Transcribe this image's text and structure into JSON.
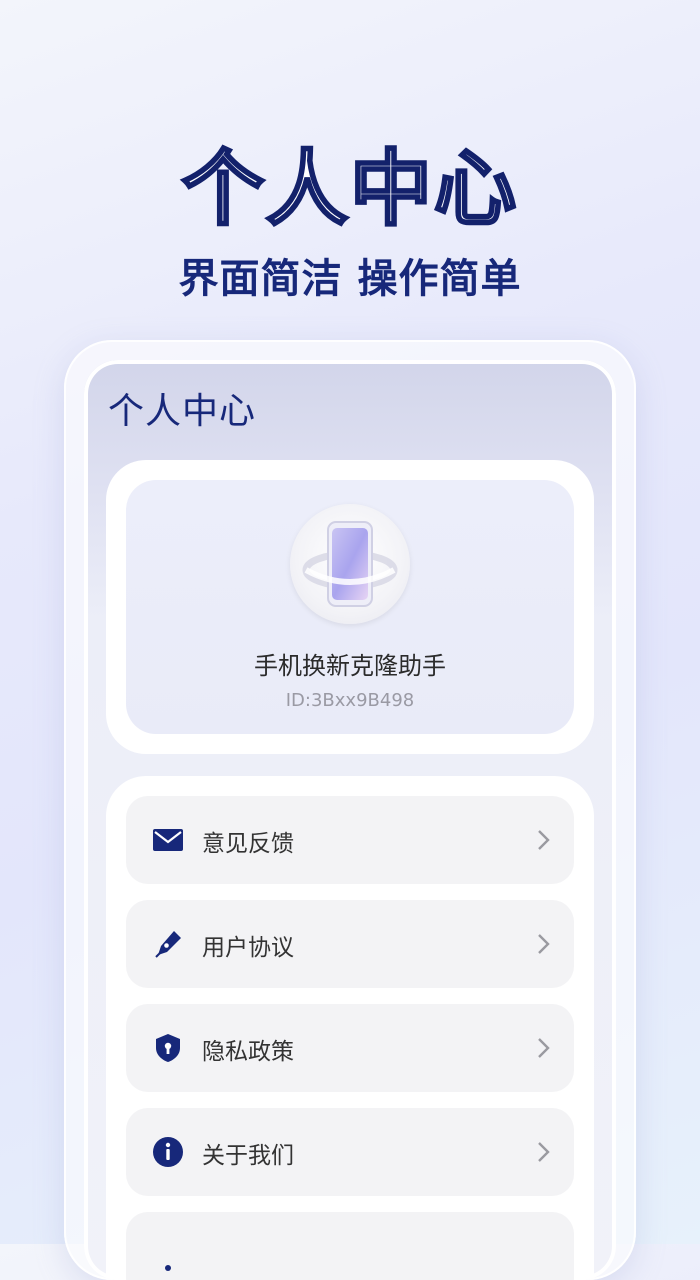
{
  "hero": {
    "title": "个人中心",
    "subtitle": "界面简洁 操作简单"
  },
  "screen": {
    "title": "个人中心",
    "profile": {
      "app_name": "手机换新克隆助手",
      "id_text": "ID:3Bxx9B498",
      "avatar_icon": "phone-clone-logo-icon"
    },
    "menu": [
      {
        "label": "意见反馈",
        "icon": "mail-icon"
      },
      {
        "label": "用户协议",
        "icon": "pen-icon"
      },
      {
        "label": "隐私政策",
        "icon": "shield-lock-icon"
      },
      {
        "label": "关于我们",
        "icon": "info-icon"
      }
    ]
  },
  "colors": {
    "accent": "#17287a",
    "menu_bg": "#f3f3f5"
  }
}
